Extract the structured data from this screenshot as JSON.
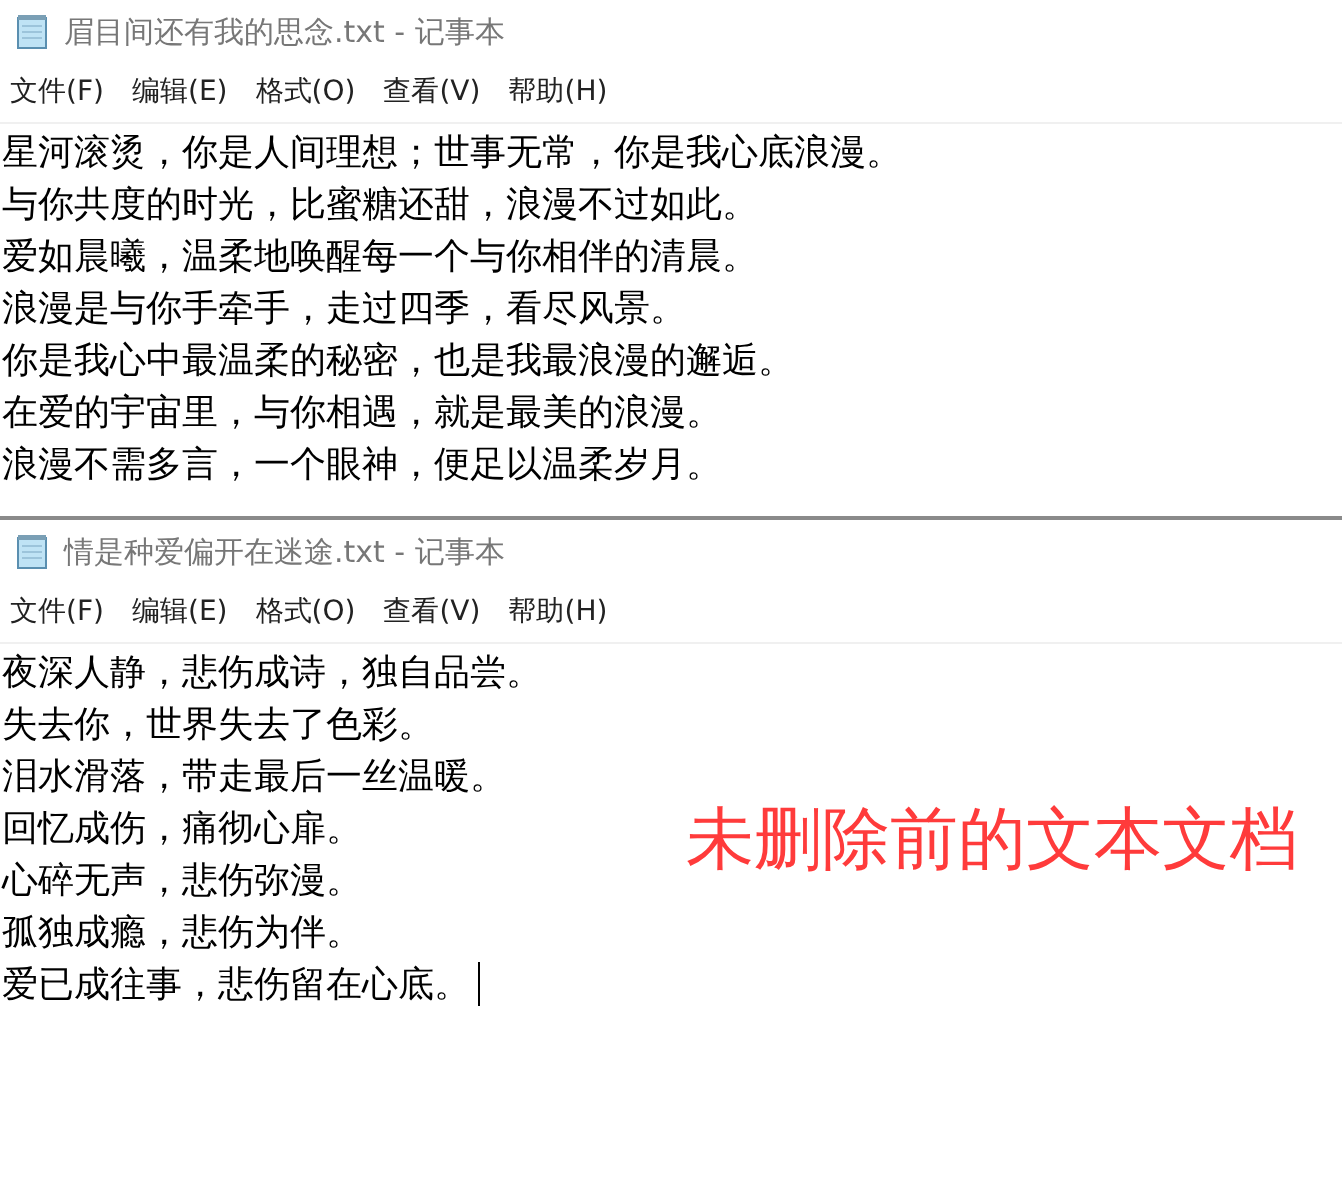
{
  "windows": [
    {
      "title": "眉目间还有我的思念.txt - 记事本",
      "menu": [
        "文件(F)",
        "编辑(E)",
        "格式(O)",
        "查看(V)",
        "帮助(H)"
      ],
      "lines": [
        "星河滚烫，你是人间理想；世事无常，你是我心底浪漫。",
        "与你共度的时光，比蜜糖还甜，浪漫不过如此。",
        "爱如晨曦，温柔地唤醒每一个与你相伴的清晨。",
        "浪漫是与你手牵手，走过四季，看尽风景。",
        "你是我心中最温柔的秘密，也是我最浪漫的邂逅。",
        "在爱的宇宙里，与你相遇，就是最美的浪漫。",
        "浪漫不需多言，一个眼神，便足以温柔岁月。"
      ],
      "caret": false
    },
    {
      "title": "情是种爱偏开在迷途.txt - 记事本",
      "menu": [
        "文件(F)",
        "编辑(E)",
        "格式(O)",
        "查看(V)",
        "帮助(H)"
      ],
      "lines": [
        "夜深人静，悲伤成诗，独自品尝。",
        "失去你，世界失去了色彩。",
        "泪水滑落，带走最后一丝温暖。",
        "回忆成伤，痛彻心扉。",
        "心碎无声，悲伤弥漫。",
        "孤独成瘾，悲伤为伴。",
        "爱已成往事，悲伤留在心底。"
      ],
      "caret": true
    }
  ],
  "annotation": "未删除前的文本文档"
}
